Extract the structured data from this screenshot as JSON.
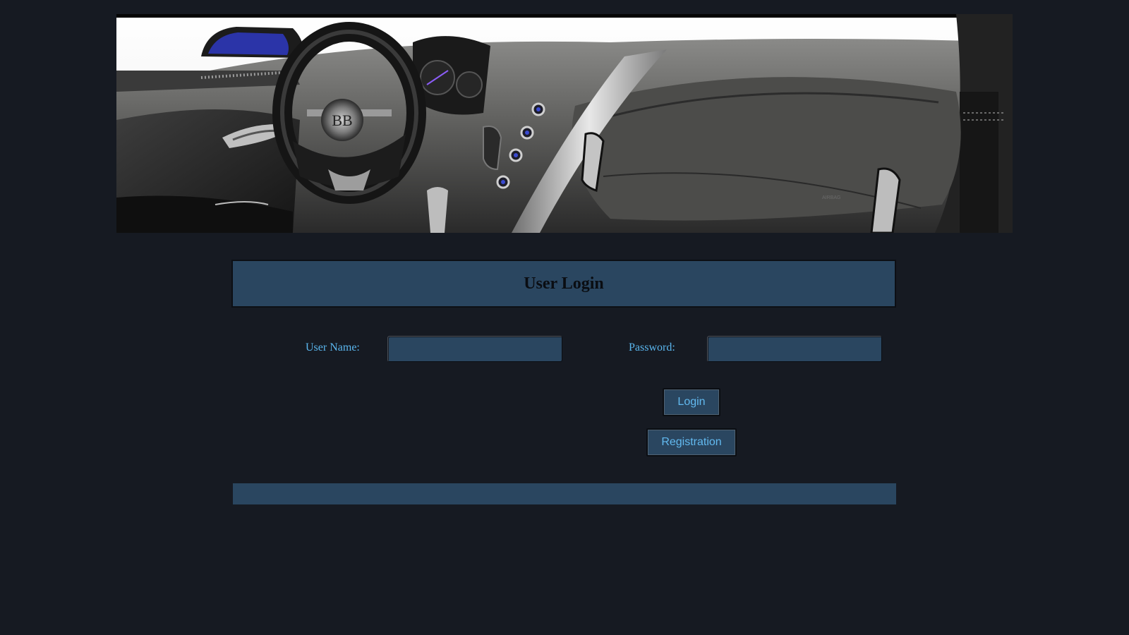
{
  "banner": {
    "image_description_icon": "car-interior-icon"
  },
  "login": {
    "title": "User Login",
    "username_label": "User Name:",
    "username_value": "",
    "password_label": "Password:",
    "password_value": "",
    "login_button": "Login",
    "registration_button": "Registration"
  },
  "colors": {
    "background": "#161a22",
    "panel": "#2a4660",
    "label_text": "#5ab6ee",
    "title_text": "#0a0d12"
  }
}
